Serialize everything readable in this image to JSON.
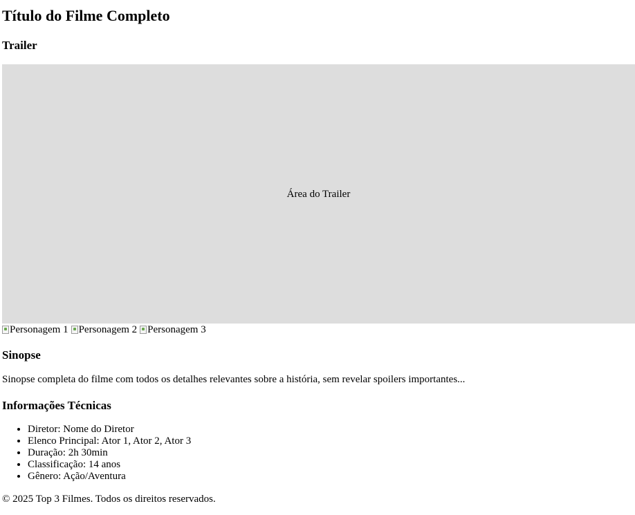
{
  "header": {
    "title": "Título do Filme Completo"
  },
  "trailer": {
    "heading": "Trailer",
    "placeholder": "Área do Trailer"
  },
  "characters": [
    {
      "alt": "Personagem 1"
    },
    {
      "alt": "Personagem 2"
    },
    {
      "alt": "Personagem 3"
    }
  ],
  "synopsis": {
    "heading": "Sinopse",
    "text": "Sinopse completa do filme com todos os detalhes relevantes sobre a história, sem revelar spoilers importantes..."
  },
  "tech": {
    "heading": "Informações Técnicas",
    "items": [
      "Diretor: Nome do Diretor",
      "Elenco Principal: Ator 1, Ator 2, Ator 3",
      "Duração: 2h 30min",
      "Classificação: 14 anos",
      "Gênero: Ação/Aventura"
    ]
  },
  "footer": {
    "text": "© 2025 Top 3 Filmes. Todos os direitos reservados."
  }
}
